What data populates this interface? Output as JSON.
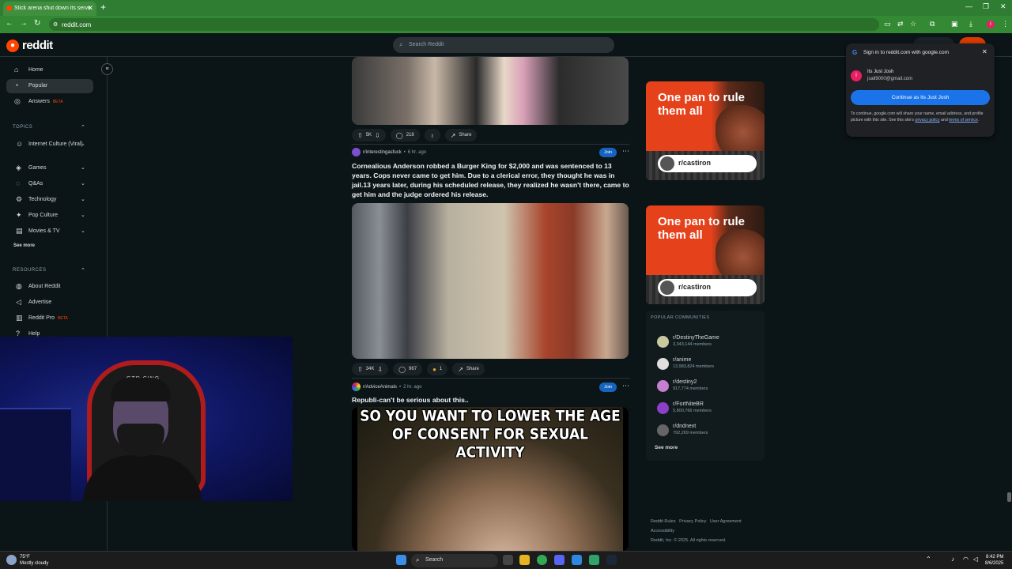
{
  "browser": {
    "tab_title": "Stick arena shut down its serve",
    "url": "reddit.com"
  },
  "header": {
    "logo_text": "reddit",
    "search_placeholder": "Search Reddit"
  },
  "sidebar": {
    "nav": [
      {
        "label": "Home",
        "icon": "home-icon"
      },
      {
        "label": "Popular",
        "icon": "popular-icon"
      },
      {
        "label": "Answers",
        "beta": "BETA",
        "icon": "answers-icon"
      }
    ],
    "topics_title": "TOPICS",
    "topics": [
      {
        "label": "Internet Culture (Viral)"
      },
      {
        "label": "Games"
      },
      {
        "label": "Q&As"
      },
      {
        "label": "Technology"
      },
      {
        "label": "Pop Culture"
      },
      {
        "label": "Movies & TV"
      }
    ],
    "see_more": "See more",
    "resources_title": "RESOURCES",
    "resources": [
      {
        "label": "About Reddit"
      },
      {
        "label": "Advertise"
      },
      {
        "label": "Reddit Pro",
        "beta": "BETA"
      },
      {
        "label": "Help"
      }
    ]
  },
  "webcam": {
    "chair_label": "GTR CING"
  },
  "posts": [
    {
      "votes": "5K",
      "comments": "218",
      "share": "Share"
    },
    {
      "subreddit": "r/interestingasfuck",
      "time": "6 hr. ago",
      "join": "Join",
      "title": "Cornealious Anderson robbed a Burger King for $2,000 and was sentenced to 13 years. Cops never came to get him. Due to a clerical error, they thought he was in jail.13 years later, during his scheduled release, they realized he wasn't there, came to get him and the judge ordered his release.",
      "votes": "34K",
      "comments": "967",
      "awards": "1",
      "share": "Share"
    },
    {
      "subreddit": "r/AdviceAnimals",
      "time": "2 hr. ago",
      "join": "Join",
      "title": "Republi-can't be serious about this..",
      "meme_text": "SO YOU WANT TO LOWER THE AGE OF CONSENT FOR SEXUAL ACTIVITY"
    }
  ],
  "ads": [
    {
      "headline": "One pan to rule them all",
      "community": "r/castiron"
    },
    {
      "headline": "One pan to rule them all",
      "community": "r/castiron"
    }
  ],
  "popular": {
    "title": "POPULAR COMMUNITIES",
    "communities": [
      {
        "name": "r/DestinyTheGame",
        "members": "3,343,144 members",
        "color": "#c9c9a0"
      },
      {
        "name": "r/anime",
        "members": "13,983,824 members",
        "color": "#e0e0e0"
      },
      {
        "name": "r/destiny2",
        "members": "917,774 members",
        "color": "#c77fd0"
      },
      {
        "name": "r/FortNiteBR",
        "members": "5,800,766 members",
        "color": "#8e3fc8"
      },
      {
        "name": "r/dndnext",
        "members": "792,269 members",
        "color": "#666666"
      }
    ],
    "see_more": "See more"
  },
  "footer": {
    "links": [
      "Reddit Rules",
      "Privacy Policy",
      "User Agreement"
    ],
    "accessibility": "Accessibility",
    "copyright": "Reddit, Inc. © 2025. All rights reserved."
  },
  "google_signin": {
    "title": "Sign in to reddit.com with google.com",
    "user_name": "Its Just Josh",
    "user_email": "jsall9000@gmail.com",
    "avatar_letter": "I",
    "button": "Continue as Its Just Josh",
    "disclaimer": "To continue, google.com will share your name, email address, and profile picture with this site. See this site's",
    "privacy_link": "privacy policy",
    "and_text": "and",
    "terms_link": "terms of service"
  },
  "taskbar": {
    "temperature": "75°F",
    "weather": "Mostly cloudy",
    "search": "Search",
    "time": "8:42 PM",
    "date": "8/6/2025"
  }
}
